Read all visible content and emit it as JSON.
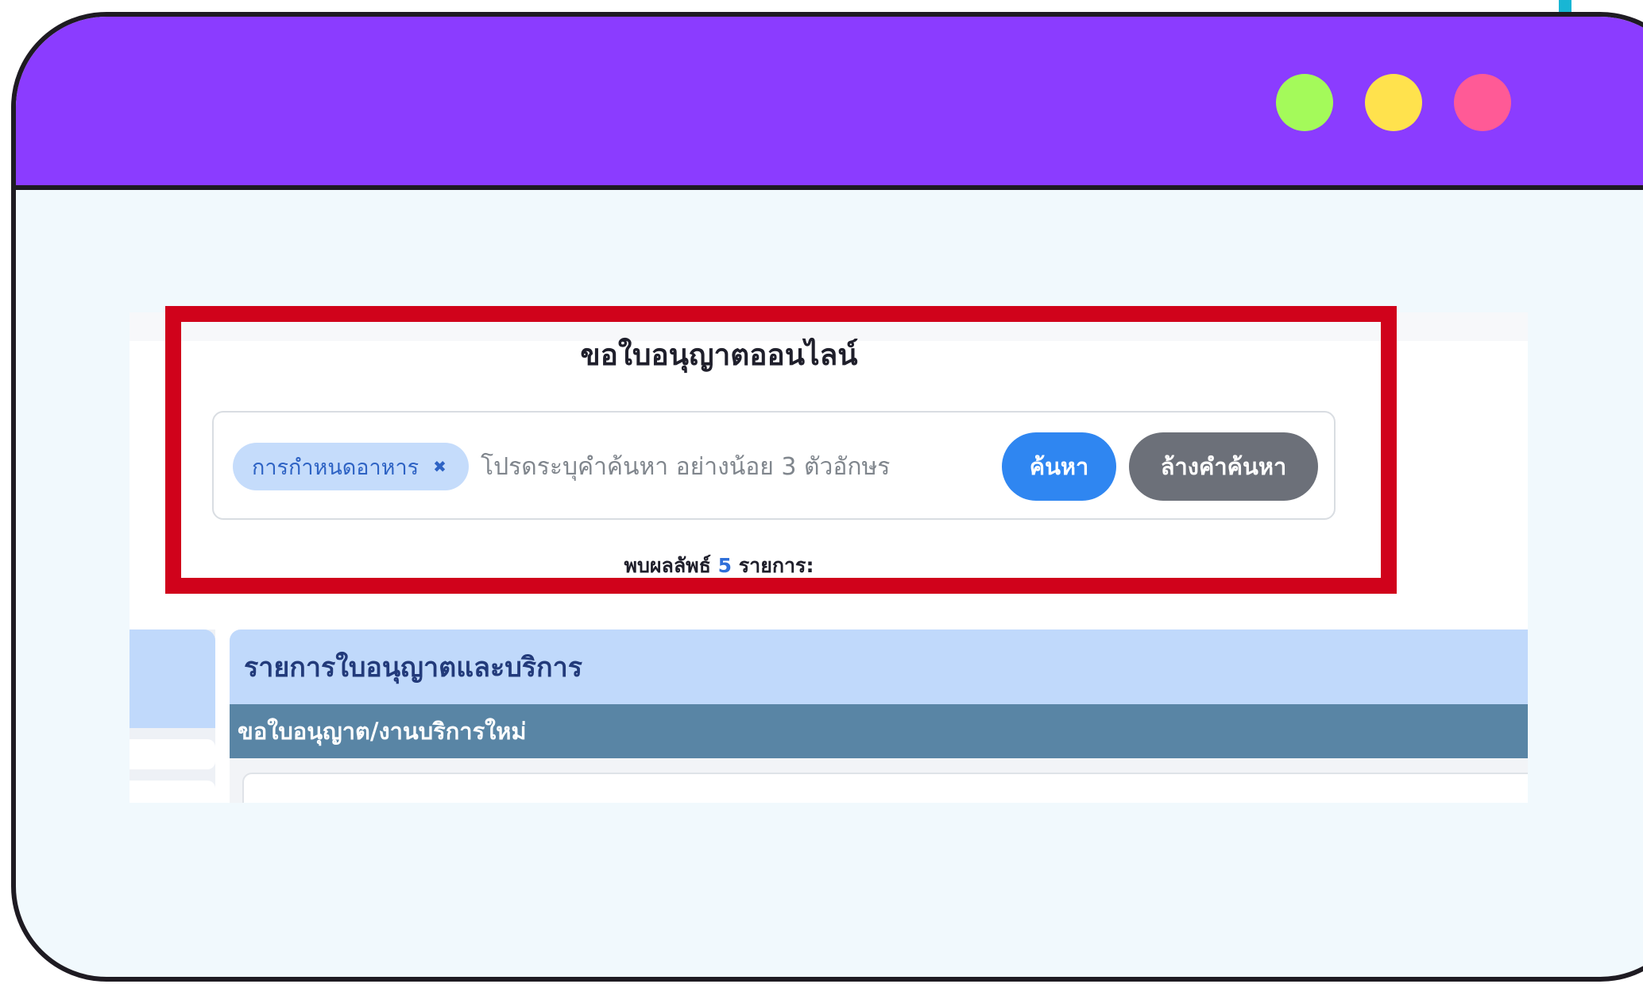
{
  "window": {
    "dots": [
      "green",
      "yellow",
      "pink"
    ],
    "accent_color": "#8b3cff"
  },
  "page": {
    "title": "ขอใบอนุญาตออนไลน์"
  },
  "search": {
    "tag_label": "การกำหนดอาหาร",
    "tag_remove_icon": "x-icon",
    "placeholder": "โปรดระบุคำค้นหา อย่างน้อย 3 ตัวอักษร",
    "value": "",
    "search_button": "ค้นหา",
    "clear_button": "ล้างคำค้นหา"
  },
  "results": {
    "prefix": "พบผลลัพธ์",
    "count": "5",
    "suffix": "รายการ:"
  },
  "list": {
    "header": "รายการใบอนุญาตและบริการ",
    "subheader": "ขอใบอนุญาต/งานบริการใหม่"
  },
  "colors": {
    "highlight": "#d0021b",
    "primary_button": "#2f86f1",
    "secondary_button": "#6c7079"
  }
}
